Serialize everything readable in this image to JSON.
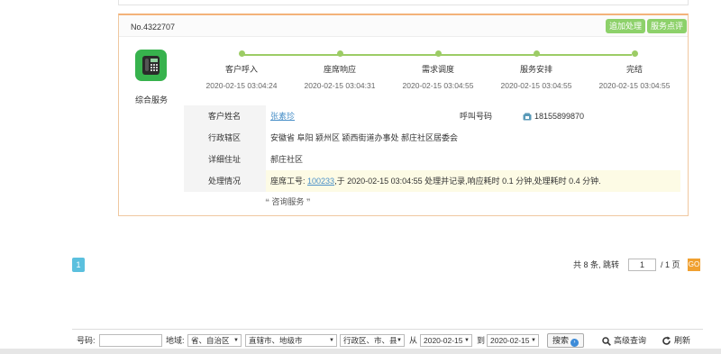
{
  "record": {
    "number": "No.4322707",
    "add_button": "追加处理",
    "rate_button": "服务点评",
    "category": "综合服务",
    "timeline": [
      {
        "name": "客户呼入",
        "time": "2020-02-15 03:04:24"
      },
      {
        "name": "座席响应",
        "time": "2020-02-15 03:04:31"
      },
      {
        "name": "需求调度",
        "time": "2020-02-15 03:04:55"
      },
      {
        "name": "服务安排",
        "time": "2020-02-15 03:04:55"
      },
      {
        "name": "完结",
        "time": "2020-02-15 03:04:55"
      }
    ],
    "fields": {
      "customer_label": "客户姓名",
      "customer_value": "张素珍",
      "caller_label": "呼叫号码",
      "caller_value": "18155899870",
      "region_label": "行政辖区",
      "region_value": "安徽省 阜阳 颍州区 颍西街道办事处 郝庄社区居委会",
      "address_label": "详细住址",
      "address_value": "郝庄社区",
      "process_label": "处理情况",
      "process_prefix": "座席工号: ",
      "process_agent": "100233",
      "process_suffix": ",于 2020-02-15 03:04:55 处理并记录,响应耗时 0.1 分钟,处理耗时 0.4 分钟.",
      "service_tag": "咨询服务"
    }
  },
  "pagination": {
    "current_page": "1",
    "summary": "共 8 条, 跳转",
    "page_input": "1",
    "total": "/ 1 页",
    "go": "GO"
  },
  "filter": {
    "number_label": "号码:",
    "number_value": "",
    "region_label": "地域:",
    "province_value": "省、自治区",
    "city_placeholder": "直辖市、地级市",
    "district_placeholder": "行政区、市、县",
    "from_label": "从",
    "from_date": "2020-02-15",
    "to_label": "到",
    "to_date": "2020-02-15",
    "search_label": "搜索",
    "advanced_label": "高级查询",
    "refresh_label": "刷新"
  },
  "colors": {
    "accent_green": "#8dd16a",
    "timeline_green": "#9ccc65",
    "link_blue": "#4a90c8",
    "card_border": "#f3b27a",
    "go_orange": "#f0a030"
  }
}
